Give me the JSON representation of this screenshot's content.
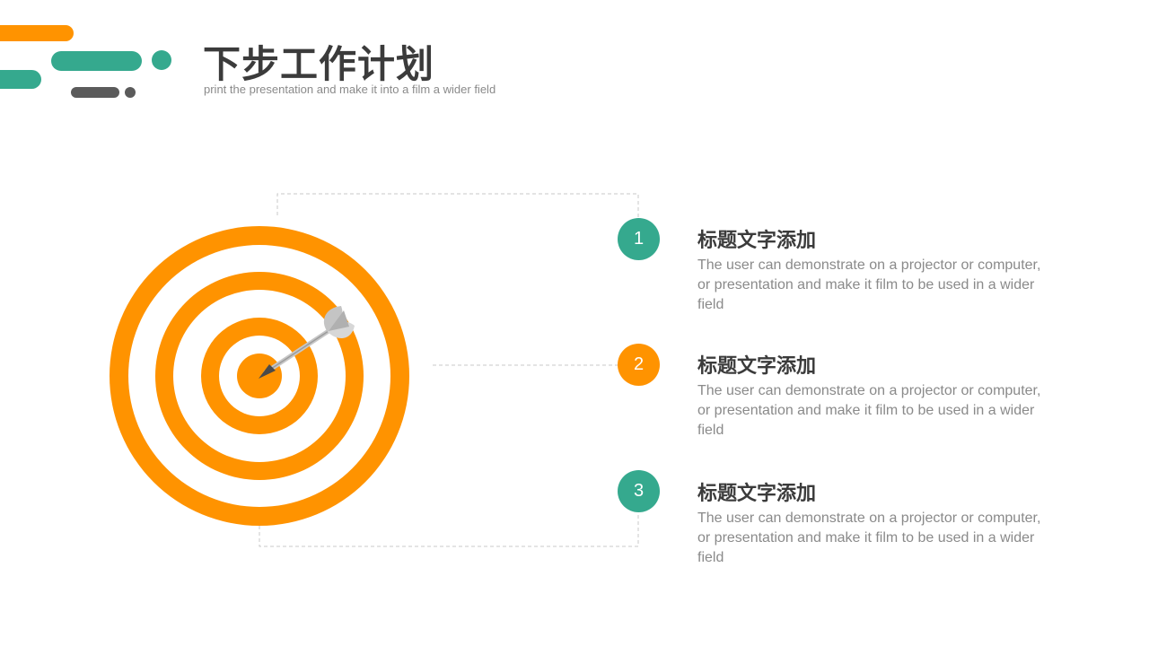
{
  "header": {
    "title": "下步工作计划",
    "subtitle": "print the presentation and make it into a film a wider field"
  },
  "colors": {
    "orange": "#FF9300",
    "teal": "#35A98E",
    "gray": "#5B5B5B",
    "text_dark": "#3B3B3B",
    "text_light": "#8A8A8A"
  },
  "items": [
    {
      "number": "1",
      "title": "标题文字添加",
      "description": "The user can demonstrate on a projector or computer, or presentation and make it film to be used in a wider field"
    },
    {
      "number": "2",
      "title": "标题文字添加",
      "description": "The user can demonstrate on a projector or computer, or presentation and make it film to be used in a wider field"
    },
    {
      "number": "3",
      "title": "标题文字添加",
      "description": "The user can demonstrate on a projector or computer, or presentation and make it film to be used in a wider field"
    }
  ],
  "illustration": {
    "target_icon": "target-icon",
    "dart_icon": "dart-icon"
  }
}
